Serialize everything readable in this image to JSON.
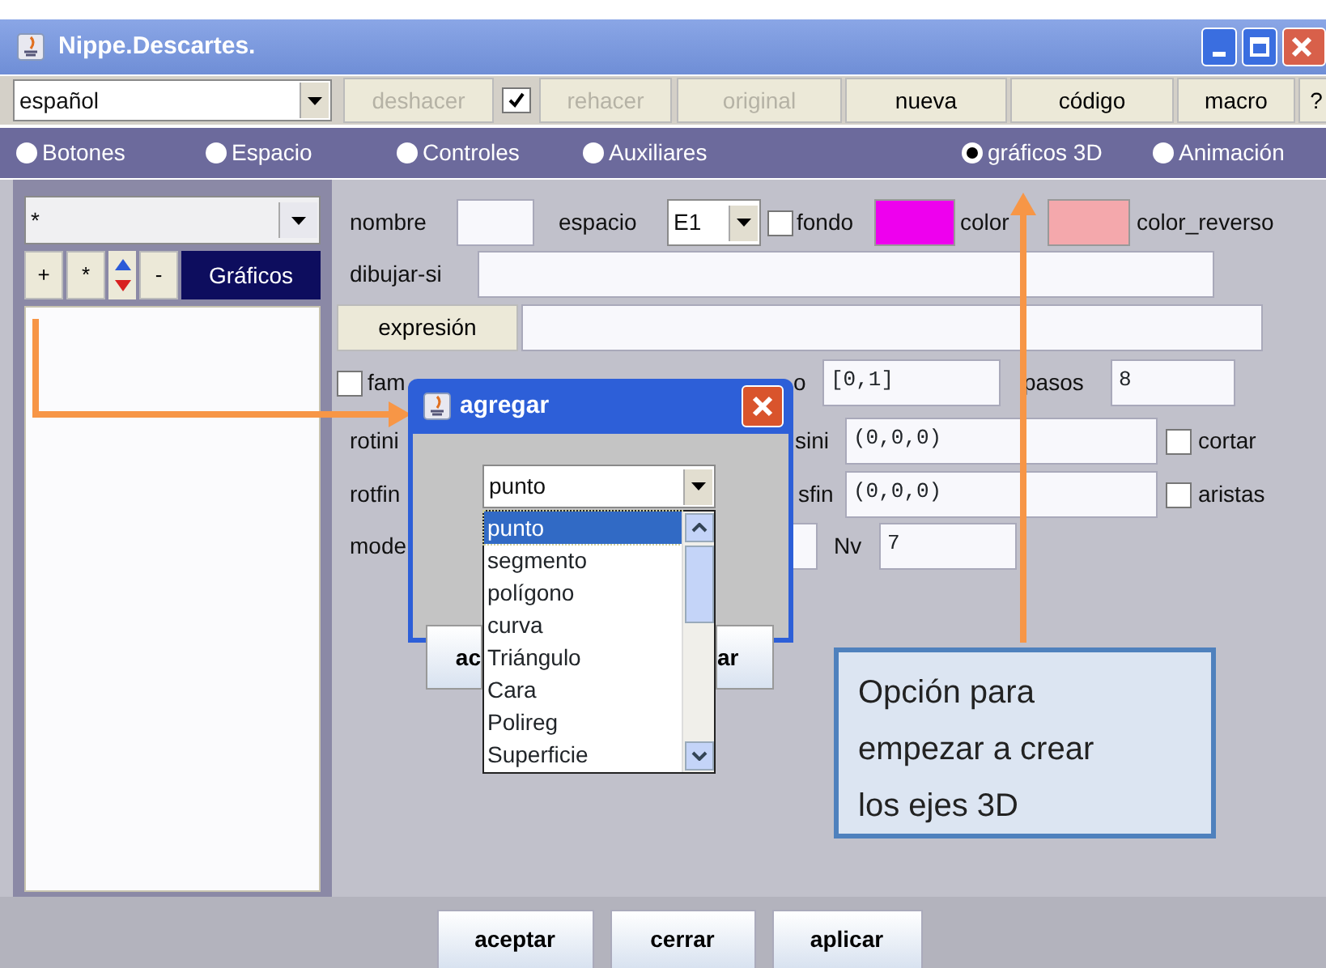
{
  "window": {
    "title": "Nippe.Descartes."
  },
  "toolbar": {
    "language": "español",
    "items": [
      {
        "kind": "button",
        "label": "deshacer",
        "disabled": true
      },
      {
        "kind": "checkbox",
        "checked": true
      },
      {
        "kind": "button",
        "label": "rehacer",
        "disabled": true
      },
      {
        "kind": "button",
        "label": "original",
        "disabled": true
      },
      {
        "kind": "button",
        "label": "nueva",
        "disabled": false
      },
      {
        "kind": "button",
        "label": "código",
        "disabled": false
      },
      {
        "kind": "button",
        "label": "macro",
        "disabled": false
      },
      {
        "kind": "button",
        "label": "?",
        "disabled": false
      }
    ]
  },
  "tabs": [
    {
      "label": "Botones",
      "selected": false
    },
    {
      "label": "Espacio",
      "selected": false
    },
    {
      "label": "Controles",
      "selected": false
    },
    {
      "label": "Auxiliares",
      "selected": false
    },
    {
      "label": "gráficos 3D",
      "selected": true
    },
    {
      "label": "Animación",
      "selected": false
    }
  ],
  "sidebar": {
    "filter": "*",
    "items": [
      {
        "kind": "button",
        "label": "+"
      },
      {
        "kind": "button",
        "label": "*"
      },
      {
        "kind": "order"
      },
      {
        "kind": "button",
        "label": "-"
      },
      {
        "kind": "title",
        "label": "Gráficos"
      }
    ]
  },
  "form": {
    "lines": [
      {
        "items": [
          {
            "kind": "label",
            "text": "nombre"
          },
          {
            "kind": "field"
          },
          {
            "kind": "label",
            "text": "espacio"
          },
          {
            "kind": "combo",
            "value": "E1"
          },
          {
            "kind": "checkbox",
            "checked": false
          },
          {
            "kind": "label",
            "text": "fondo"
          },
          {
            "kind": "swatch",
            "color": "#ee00ee"
          },
          {
            "kind": "label",
            "text": "color"
          },
          {
            "kind": "swatch",
            "color": "#f4a8ac"
          },
          {
            "kind": "label",
            "text": "color_reverso"
          }
        ]
      },
      {
        "items": [
          {
            "kind": "label",
            "text": "dibujar-si"
          },
          {
            "kind": "field"
          }
        ]
      },
      {
        "items": [
          {
            "kind": "button",
            "label": "expresión"
          },
          {
            "kind": "field"
          }
        ]
      },
      {
        "items": [
          {
            "kind": "checkbox",
            "checked": false
          },
          {
            "kind": "label",
            "text": "fam"
          },
          {
            "kind": "label",
            "text": "o"
          },
          {
            "kind": "field",
            "value": "[0,1]"
          },
          {
            "kind": "label",
            "text": "pasos"
          },
          {
            "kind": "field",
            "value": "8"
          }
        ]
      },
      {
        "items": [
          {
            "kind": "label",
            "text": "rotini"
          },
          {
            "kind": "label",
            "text": "sini"
          },
          {
            "kind": "field",
            "value": "(0,0,0)"
          },
          {
            "kind": "checkbox",
            "checked": false
          },
          {
            "kind": "label",
            "text": "cortar"
          }
        ]
      },
      {
        "items": [
          {
            "kind": "label",
            "text": "rotfin"
          },
          {
            "kind": "label",
            "text": "sfin"
          },
          {
            "kind": "field",
            "value": "(0,0,0)"
          },
          {
            "kind": "checkbox",
            "checked": false
          },
          {
            "kind": "label",
            "text": "aristas"
          }
        ]
      },
      {
        "items": [
          {
            "kind": "label",
            "text": "mode"
          },
          {
            "kind": "field"
          },
          {
            "kind": "label",
            "text": "Nv"
          },
          {
            "kind": "field",
            "value": "7"
          }
        ]
      }
    ]
  },
  "dialog": {
    "title": "agregar",
    "value": "punto",
    "options": [
      {
        "label": "punto",
        "selected": true
      },
      {
        "label": "segmento",
        "selected": false
      },
      {
        "label": "polígono",
        "selected": false
      },
      {
        "label": "curva",
        "selected": false
      },
      {
        "label": "Triángulo",
        "selected": false
      },
      {
        "label": "Cara",
        "selected": false
      },
      {
        "label": "Polireg",
        "selected": false
      },
      {
        "label": "Superficie",
        "selected": false
      }
    ],
    "buttons": [
      "ac",
      "ar"
    ]
  },
  "callout": {
    "text": "Opción para empezar a crear los ejes 3D"
  },
  "buttons": [
    "aceptar",
    "cerrar",
    "aplicar"
  ]
}
